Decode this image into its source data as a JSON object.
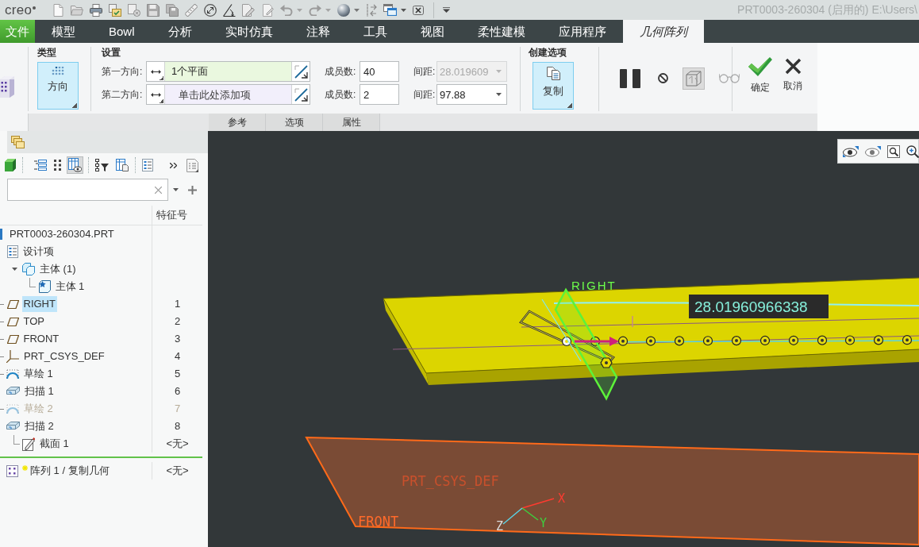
{
  "quick_access": {
    "logo": "creo"
  },
  "window": {
    "title": "PRT0003-260304 (启用的) E:\\Users\\"
  },
  "tabs": [
    {
      "label": "文件",
      "kind": "file",
      "selected": false
    },
    {
      "label": "模型",
      "kind": "tab",
      "selected": false
    },
    {
      "label": "Bowl",
      "kind": "tab",
      "selected": false
    },
    {
      "label": "分析",
      "kind": "tab",
      "selected": false
    },
    {
      "label": "实时仿真",
      "kind": "tab",
      "selected": false
    },
    {
      "label": "注释",
      "kind": "tab",
      "selected": false
    },
    {
      "label": "工具",
      "kind": "tab",
      "selected": false
    },
    {
      "label": "视图",
      "kind": "tab",
      "selected": false
    },
    {
      "label": "柔性建模",
      "kind": "tab",
      "selected": false
    },
    {
      "label": "应用程序",
      "kind": "tab",
      "selected": false
    },
    {
      "label": "几何阵列",
      "kind": "tab",
      "selected": true
    }
  ],
  "ribbon": {
    "type_group": {
      "title": "类型",
      "button": {
        "label": "方向",
        "selected": true
      }
    },
    "settings": {
      "title": "设置",
      "rows": [
        {
          "label": "第一方向:",
          "reference": {
            "value": "1个平面"
          },
          "members_label": "成员数:",
          "members": "40",
          "spacing_label": "间距:",
          "spacing": "28.019609",
          "spacing_disabled": true
        },
        {
          "label": "第二方向:",
          "reference": {
            "placeholder": "单击此处添加项"
          },
          "members_label": "成员数:",
          "members": "2",
          "spacing_label": "间距:",
          "spacing": "97.88",
          "spacing_disabled": false
        }
      ]
    },
    "options_group": {
      "title": "创建选项",
      "button": {
        "label": "复制",
        "selected": true
      }
    },
    "preview_tools": [
      {
        "selected": false,
        "disabled": false
      },
      {
        "selected": false,
        "disabled": false
      },
      {
        "selected": true,
        "disabled": false
      },
      {
        "selected": false,
        "disabled": true
      }
    ],
    "actions": [
      {
        "label": "确定",
        "kind": "ok"
      },
      {
        "label": "取消",
        "kind": "cancel"
      }
    ],
    "panel_tabs": [
      {
        "label": "参考",
        "selected": false
      },
      {
        "label": "选项",
        "selected": false
      },
      {
        "label": "属性",
        "selected": false
      }
    ]
  },
  "model_tree": {
    "tools": [
      {
        "selected": false
      },
      {
        "selected": false
      },
      {
        "selected": false
      },
      {
        "selected": true
      },
      {
        "selected": false
      },
      {
        "selected": false
      },
      {
        "selected": false
      },
      {
        "selected": false
      },
      {
        "selected": false
      }
    ],
    "column_header": "特征号",
    "items": [
      {
        "name": "PRT0003-260304.PRT",
        "kind": "part",
        "selected": false,
        "hidden": false,
        "children": [
          {
            "name": "设计项",
            "kind": "design-items",
            "selected": false,
            "hidden": false,
            "children": [
              {
                "name": "主体 (1)",
                "kind": "body-group",
                "selected": false,
                "hidden": false,
                "children": [
                  {
                    "name": "主体 1",
                    "kind": "body",
                    "selected": false,
                    "hidden": false
                  }
                ]
              }
            ]
          },
          {
            "name": "RIGHT",
            "kind": "plane",
            "number": "1",
            "selected": true,
            "hidden": false
          },
          {
            "name": "TOP",
            "kind": "plane",
            "number": "2",
            "selected": false,
            "hidden": false
          },
          {
            "name": "FRONT",
            "kind": "plane",
            "number": "3",
            "selected": false,
            "hidden": false
          },
          {
            "name": "PRT_CSYS_DEF",
            "kind": "csys",
            "number": "4",
            "selected": false,
            "hidden": false
          },
          {
            "name": "草绘 1",
            "kind": "sketch",
            "number": "5",
            "selected": false,
            "hidden": false
          },
          {
            "name": "扫描 1",
            "kind": "sweep",
            "number": "6",
            "selected": false,
            "hidden": false
          },
          {
            "name": "草绘 2",
            "kind": "sketch",
            "number": "7",
            "selected": false,
            "hidden": true
          },
          {
            "name": "扫描 2",
            "kind": "sweep",
            "number": "8",
            "selected": false,
            "hidden": false,
            "children": [
              {
                "name": "截面 1",
                "kind": "section",
                "number": "<无>",
                "selected": false,
                "hidden": false
              }
            ]
          }
        ]
      }
    ],
    "pending": [
      {
        "name": "阵列 1 / 复制几何",
        "kind": "pattern",
        "number": "<无>"
      }
    ]
  },
  "viewport": {
    "labels": [
      {
        "text": "RIGHT",
        "kind": "plane-tag"
      },
      {
        "text": "28.01960966338",
        "kind": "dimension"
      },
      {
        "text": "PRT_CSYS_DEF",
        "kind": "csys-name"
      },
      {
        "text": "X",
        "kind": "axis-x"
      },
      {
        "text": "FRONT",
        "kind": "plane-name"
      },
      {
        "text": "Z",
        "kind": "axis-z"
      },
      {
        "text": "Y",
        "kind": "axis-y"
      }
    ]
  }
}
